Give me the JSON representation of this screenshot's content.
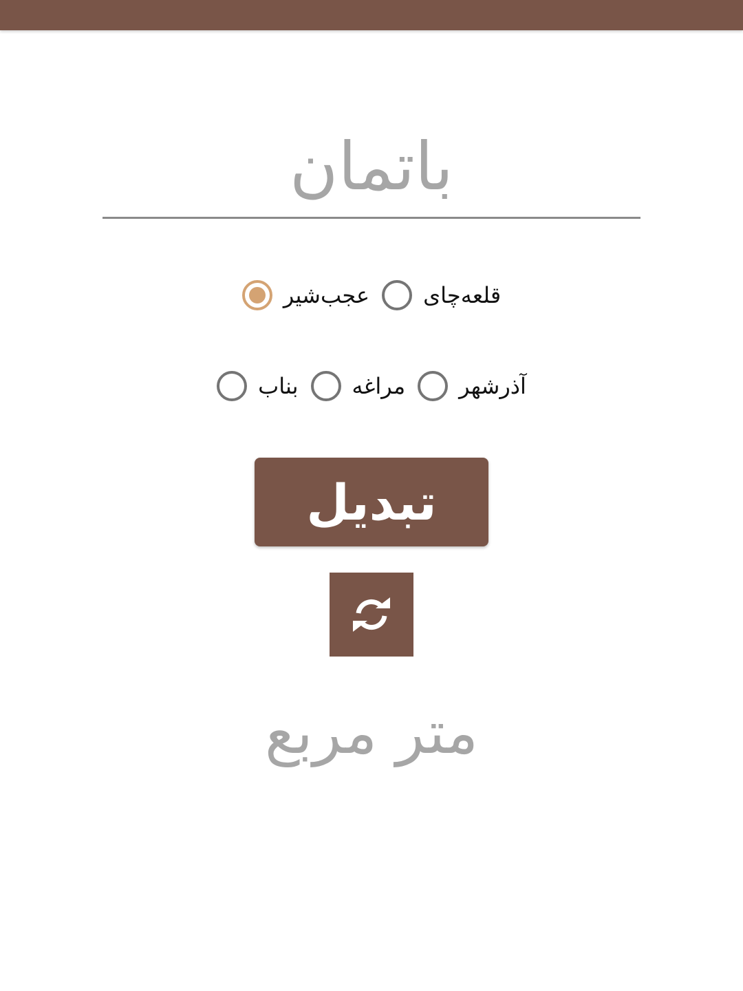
{
  "input": {
    "value": "",
    "placeholder": "باتمان"
  },
  "radio_groups": {
    "row1": [
      {
        "label": "قلعه‌چای",
        "checked": false
      },
      {
        "label": "عجب‌شیر",
        "checked": true
      }
    ],
    "row2": [
      {
        "label": "آذرشهر",
        "checked": false
      },
      {
        "label": "مراغه",
        "checked": false
      },
      {
        "label": "بناب",
        "checked": false
      }
    ]
  },
  "convert_button": {
    "label": "تبدیل"
  },
  "swap_button": {
    "icon": "refresh-icon"
  },
  "result": {
    "text": "متر مربع"
  },
  "colors": {
    "primary": "#795548",
    "accent": "#d4a373",
    "hint": "#a6a6a6"
  }
}
